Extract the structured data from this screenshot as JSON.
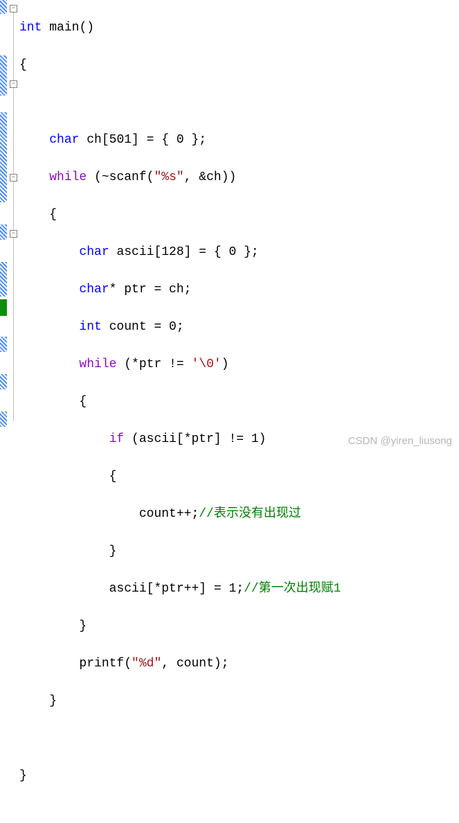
{
  "code": {
    "l1": {
      "kw_int": "int",
      "main": "main",
      "p": "()"
    },
    "l2": {
      "brace": "{"
    },
    "l4": {
      "kw_char": "char",
      "decl": " ch[501] = { 0 };"
    },
    "l5": {
      "kw_while": "while",
      "cond_open": " (~",
      "scanf": "scanf",
      "paren_o": "(",
      "str": "\"%s\"",
      "rest": ", &ch))"
    },
    "l6": {
      "brace": "{"
    },
    "l7": {
      "kw_char": "char",
      "decl": " ascii[128] = { 0 };"
    },
    "l8": {
      "kw_char": "char",
      "decl": "* ptr = ch;"
    },
    "l9": {
      "kw_int": "int",
      "decl": " count = 0;"
    },
    "l10": {
      "kw_while": "while",
      "open": " (*ptr != ",
      "chlit": "'\\0'",
      "close": ")"
    },
    "l11": {
      "brace": "{"
    },
    "l12": {
      "kw_if": "if",
      "cond": " (ascii[*ptr] != 1)"
    },
    "l13": {
      "brace": "{"
    },
    "l14": {
      "stmt": "count++;",
      "comment": "//表示没有出现过"
    },
    "l15": {
      "brace": "}"
    },
    "l16": {
      "stmt": "ascii[*ptr++] = 1;",
      "comment": "//第一次出现赋1"
    },
    "l17": {
      "brace": "}"
    },
    "l18": {
      "printf": "printf",
      "paren_o": "(",
      "str": "\"%d\"",
      "rest": ", count);"
    },
    "l19": {
      "brace": "}"
    },
    "l21": {
      "brace": "}"
    }
  },
  "watermark": "CSDN @yiren_liusong",
  "fold_minus": "−"
}
